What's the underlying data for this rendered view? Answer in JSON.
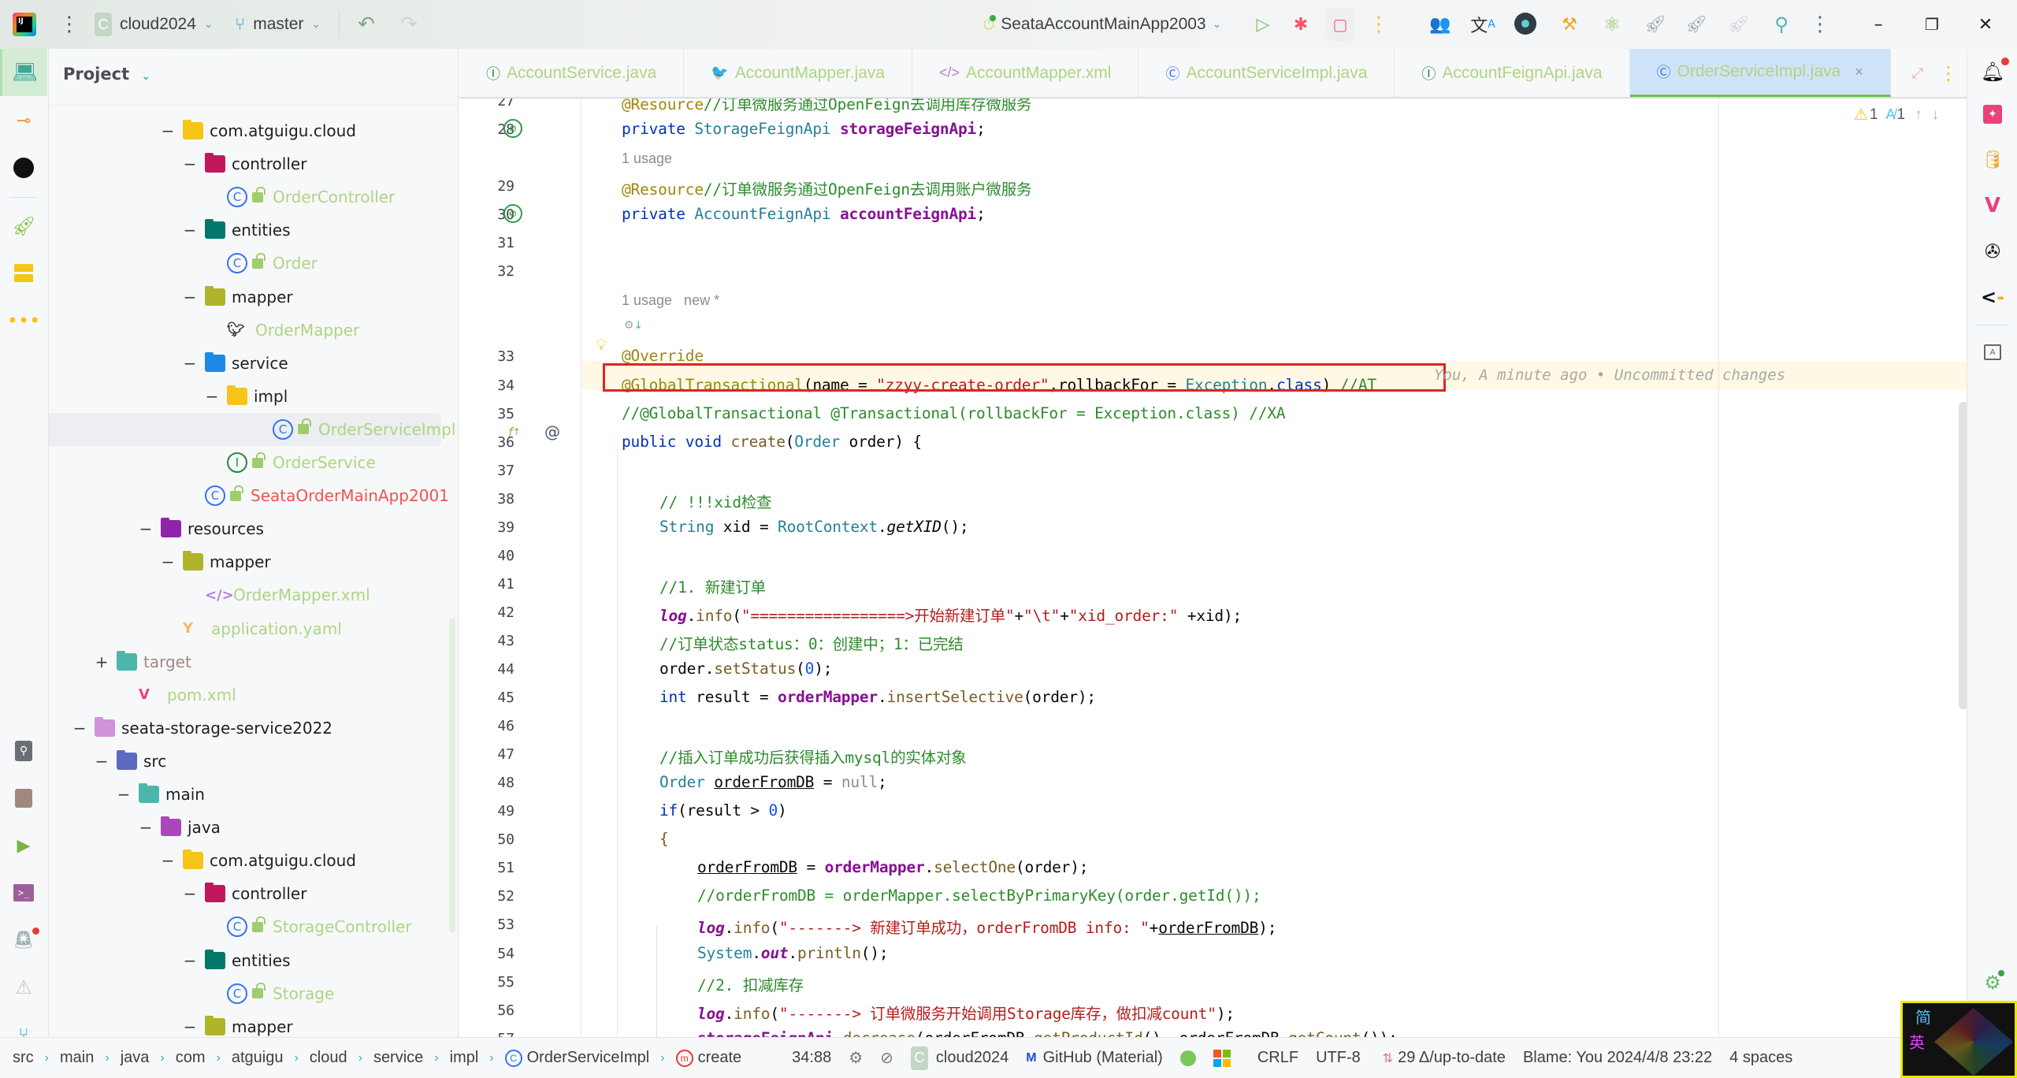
{
  "titlebar": {
    "project_letter": "C",
    "project_name": "cloud2024",
    "branch": "master",
    "run_config": "SeataAccountMainApp2003"
  },
  "tabs": [
    {
      "label": "AccountService.java",
      "icon": "interface-icon",
      "glyph": "Ⓘ",
      "color": "#208a3c"
    },
    {
      "label": "AccountMapper.java",
      "icon": "mybatis-mapper-icon",
      "glyph": "🐦",
      "color": "#333333"
    },
    {
      "label": "AccountMapper.xml",
      "icon": "xml-icon",
      "glyph": "</>",
      "color": "#b37ee0"
    },
    {
      "label": "AccountServiceImpl.java",
      "icon": "class-icon",
      "glyph": "Ⓒ",
      "color": "#3574f0"
    },
    {
      "label": "AccountFeignApi.java",
      "icon": "interface-icon",
      "glyph": "Ⓘ",
      "color": "#208a3c"
    },
    {
      "label": "OrderServiceImpl.java",
      "icon": "class-icon",
      "glyph": "Ⓒ",
      "color": "#3574f0",
      "active": true
    }
  ],
  "project": {
    "title": "Project",
    "tree": [
      {
        "label": "com.atguigu.cloud",
        "kind": "package",
        "toggle": "−",
        "depth": 4
      },
      {
        "label": "controller",
        "kind": "folder-controller",
        "toggle": "−",
        "depth": 5
      },
      {
        "label": "OrderController",
        "kind": "class",
        "depth": 6
      },
      {
        "label": "entities",
        "kind": "folder-entities",
        "toggle": "−",
        "depth": 5
      },
      {
        "label": "Order",
        "kind": "class",
        "depth": 6
      },
      {
        "label": "mapper",
        "kind": "folder-mapper",
        "toggle": "−",
        "depth": 5
      },
      {
        "label": "OrderMapper",
        "kind": "mapper",
        "depth": 6
      },
      {
        "label": "service",
        "kind": "folder-service",
        "toggle": "−",
        "depth": 5
      },
      {
        "label": "impl",
        "kind": "package",
        "toggle": "−",
        "depth": 6
      },
      {
        "label": "OrderServiceImpl",
        "kind": "class",
        "depth": 7,
        "selected": true
      },
      {
        "label": "OrderService",
        "kind": "interface",
        "depth": 6
      },
      {
        "label": "SeataOrderMainApp2001",
        "kind": "app",
        "depth": 5
      },
      {
        "label": "resources",
        "kind": "folder-resources",
        "toggle": "−",
        "depth": 3
      },
      {
        "label": "mapper",
        "kind": "folder-mapper",
        "toggle": "−",
        "depth": 4
      },
      {
        "label": "OrderMapper.xml",
        "kind": "xml",
        "depth": 5
      },
      {
        "label": "application.yaml",
        "kind": "yaml",
        "depth": 4
      },
      {
        "label": "target",
        "kind": "folder-target",
        "toggle": "+",
        "depth": 1
      },
      {
        "label": "pom.xml",
        "kind": "maven",
        "depth": 2
      },
      {
        "label": "seata-storage-service2022",
        "kind": "module",
        "toggle": "−",
        "depth": 0
      },
      {
        "label": "src",
        "kind": "folder-src",
        "toggle": "−",
        "depth": 1
      },
      {
        "label": "main",
        "kind": "folder-main",
        "toggle": "−",
        "depth": 2
      },
      {
        "label": "java",
        "kind": "folder-java",
        "toggle": "−",
        "depth": 3
      },
      {
        "label": "com.atguigu.cloud",
        "kind": "package",
        "toggle": "−",
        "depth": 4
      },
      {
        "label": "controller",
        "kind": "folder-controller",
        "toggle": "−",
        "depth": 5
      },
      {
        "label": "StorageController",
        "kind": "class",
        "depth": 6
      },
      {
        "label": "entities",
        "kind": "folder-entities",
        "toggle": "−",
        "depth": 5
      },
      {
        "label": "Storage",
        "kind": "class",
        "depth": 6
      },
      {
        "label": "mapper",
        "kind": "folder-mapper",
        "toggle": "−",
        "depth": 5
      }
    ]
  },
  "editor": {
    "inspections": {
      "warnings": "1",
      "typos": "1"
    },
    "hints": {
      "usage_29": "1 usage",
      "usage_33": "1 usage   new *"
    },
    "blame_inline": "You, A minute ago • Uncommitted changes",
    "lines": [
      {
        "n": "27",
        "html_key": "l27"
      },
      {
        "n": "28"
      },
      {
        "n": "29"
      },
      {
        "n": "30"
      },
      {
        "n": "31"
      },
      {
        "n": "32"
      },
      {
        "n": "33"
      },
      {
        "n": "34"
      },
      {
        "n": "35"
      },
      {
        "n": "36"
      },
      {
        "n": "37"
      },
      {
        "n": "38"
      },
      {
        "n": "39"
      },
      {
        "n": "40"
      },
      {
        "n": "41"
      },
      {
        "n": "42"
      },
      {
        "n": "43"
      },
      {
        "n": "44"
      },
      {
        "n": "45"
      },
      {
        "n": "46"
      },
      {
        "n": "47"
      },
      {
        "n": "48"
      },
      {
        "n": "49"
      },
      {
        "n": "50"
      },
      {
        "n": "51"
      },
      {
        "n": "52"
      },
      {
        "n": "53"
      },
      {
        "n": "54"
      },
      {
        "n": "55"
      },
      {
        "n": "56"
      },
      {
        "n": "57"
      }
    ],
    "code": {
      "l27_ann": "@Resource",
      "l27_cm": "//订单微服务通过OpenFeign去调用库存微服务",
      "l28_kw": "private",
      "l28_ty": "StorageFeignApi",
      "l28_fld": "storageFeignApi",
      "l29_ann": "@Resource",
      "l29_cm": "//订单微服务通过OpenFeign去调用账户微服务",
      "l30_kw": "private",
      "l30_ty": "AccountFeignApi",
      "l30_fld": "accountFeignApi",
      "l33_ann": "@Override",
      "l34_ann": "@GlobalTransactional",
      "l34_a": "(name = ",
      "l34_st": "\"zzyy-create-order\"",
      "l34_b": ",rollbackFor = ",
      "l34_ty": "Exception",
      "l34_c": ".",
      "l34_kw": "class",
      "l34_d": ") ",
      "l34_cm": "//AT",
      "l35_cm": "//@GlobalTransactional @Transactional(rollbackFor = Exception.class) //XA",
      "l36_kw": "public void",
      "l36_mt": "create",
      "l36_a": "(",
      "l36_ty": "Order",
      "l36_b": " order) {",
      "l38_cm": "// !!!xid检查",
      "l39_ty": "String",
      "l39_a": " xid = ",
      "l39_ty2": "RootContext",
      "l39_b": ".",
      "l39_it": "getXID",
      "l39_c": "();",
      "l41_cm": "//1. 新建订单",
      "l42_fld": "log",
      "l42_a": ".",
      "l42_mt": "info",
      "l42_b": "(",
      "l42_st": "\"=================>开始新建订单\"",
      "l42_c": "+",
      "l42_st2": "\"\\t\"",
      "l42_d": "+",
      "l42_st3": "\"xid_order:\"",
      "l42_e": " +xid);",
      "l43_cm": "//订单状态status：0：创建中；1：已完结",
      "l44_a": "order.",
      "l44_mt": "setStatus",
      "l44_b": "(",
      "l44_nu": "0",
      "l44_c": ");",
      "l45_kw": "int",
      "l45_a": " result = ",
      "l45_fld": "orderMapper",
      "l45_b": ".",
      "l45_mt": "insertSelective",
      "l45_c": "(order);",
      "l47_cm": "//插入订单成功后获得插入mysql的实体对象",
      "l48_ty": "Order",
      "l48_a": " ",
      "l48_ul": "orderFromDB",
      "l48_b": " = ",
      "l48_grey": "null",
      "l48_c": ";",
      "l49_kw": "if",
      "l49_a": "(result > ",
      "l49_nu": "0",
      "l49_b": ")",
      "l50_a": "{",
      "l51_ul": "orderFromDB",
      "l51_a": " = ",
      "l51_fld": "orderMapper",
      "l51_b": ".",
      "l51_mt": "selectOne",
      "l51_c": "(order);",
      "l52_cm": "//orderFromDB = orderMapper.selectByPrimaryKey(order.getId());",
      "l53_fld": "log",
      "l53_a": ".",
      "l53_mt": "info",
      "l53_b": "(",
      "l53_st": "\"-------> 新建订单成功，orderFromDB info: \"",
      "l53_c": "+",
      "l53_ul": "orderFromDB",
      "l53_d": ");",
      "l54_ty": "System",
      "l54_a": ".",
      "l54_fld": "out",
      "l54_b": ".",
      "l54_mt": "println",
      "l54_c": "();",
      "l55_cm": "//2. 扣减库存",
      "l56_fld": "log",
      "l56_a": ".",
      "l56_mt": "info",
      "l56_b": "(",
      "l56_st": "\"-------> 订单微服务开始调用Storage库存，做扣减count\"",
      "l56_c": ");",
      "l57_fld": "storageFeignApi",
      "l57_a": ".",
      "l57_mt": "decrease",
      "l57_b": "(orderFromDB.",
      "l57_mt2": "getProductId",
      "l57_c": "(), orderFromDB.",
      "l57_mt3": "getCount",
      "l57_d": "());"
    }
  },
  "statusbar": {
    "breadcrumbs": [
      "src",
      "main",
      "java",
      "com",
      "atguigu",
      "cloud",
      "service",
      "impl",
      "OrderServiceImpl",
      "create"
    ],
    "cursor": "34:88",
    "project_letter": "C",
    "project": "cloud2024",
    "theme": "GitHub (Material)",
    "line_sep": "CRLF",
    "encoding": "UTF-8",
    "vcs": "29 Δ/up-to-date",
    "blame": "Blame: You 2024/4/8 23:22",
    "indent": "4 spaces"
  },
  "ime": {
    "line1": "简",
    "line2": "英"
  }
}
